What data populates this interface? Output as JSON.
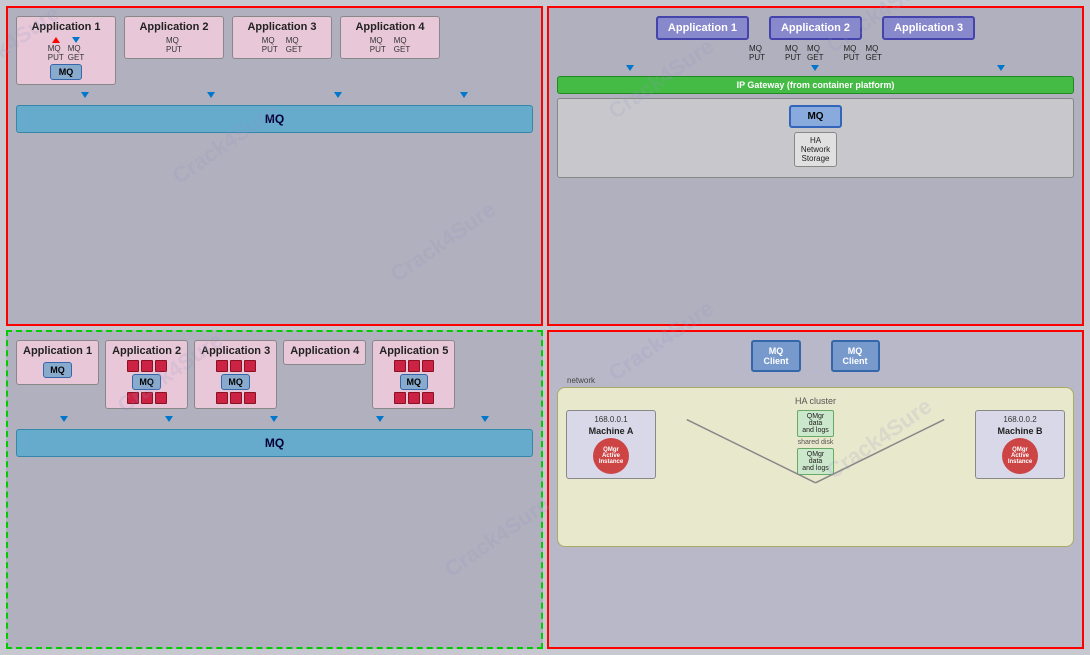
{
  "watermarks": [
    "Crack4Sure",
    "Crack4Sure",
    "Crack4Sure"
  ],
  "topLeft": {
    "apps": [
      {
        "title": "Application 1",
        "hasMqBox": true,
        "mqLabels": [
          "MQ\nPUT",
          "MQ\nGET"
        ]
      },
      {
        "title": "Application 2",
        "hasMqBox": false,
        "mqLabels": [
          "MQ\nPUT"
        ]
      },
      {
        "title": "Application 3",
        "hasMqBox": false,
        "mqLabels": [
          "MQ\nPUT",
          "MQ\nGET"
        ]
      },
      {
        "title": "Application 4",
        "hasMqBox": false,
        "mqLabels": [
          "MQ\nPUT",
          "MQ\nGET"
        ]
      }
    ],
    "mqBar": "MQ"
  },
  "topRight": {
    "apps": [
      "Application 1",
      "Application 2",
      "Application 3"
    ],
    "mqLabels1": [
      "MQ\nPUT"
    ],
    "mqLabels2": [
      "MQ\nPUT",
      "MQ\nGET"
    ],
    "mqLabels3": [
      "MQ\nPUT",
      "MQ\nGET"
    ],
    "gateway": "IP Gateway (from container platform)",
    "mq": "MQ",
    "haStorage": "HA\nNetwork\nStorage"
  },
  "bottomLeft": {
    "app1": {
      "title": "Application 1",
      "mqLabel": "MQ"
    },
    "app2": {
      "title": "Application 2",
      "mqLabel": "MQ"
    },
    "app3": {
      "title": "Application 3",
      "mqLabel": "MQ"
    },
    "app4": {
      "title": "Application 4"
    },
    "app5": {
      "title": "Application 5",
      "mqLabel": "MQ"
    },
    "mqBar": "MQ"
  },
  "bottomRight": {
    "client1": {
      "line1": "MQ",
      "line2": "Client"
    },
    "client2": {
      "line1": "MQ",
      "line2": "Client"
    },
    "networkLabel": "network",
    "haCluster": "HA cluster",
    "machine_a": {
      "ip": "168.0.0.1",
      "label": "Machine A",
      "qmgr": "QMgr\nActive\nInstance"
    },
    "machine_b": {
      "ip": "168.0.0.2",
      "label": "Machine B",
      "qmgr": "QMgr\nActive\nInstance"
    },
    "dataLogs1": "QMgr\ndata\nand logs",
    "sharedDisk": "shared disk",
    "dataLogs2": "QMgr\ndata\nand logs"
  }
}
